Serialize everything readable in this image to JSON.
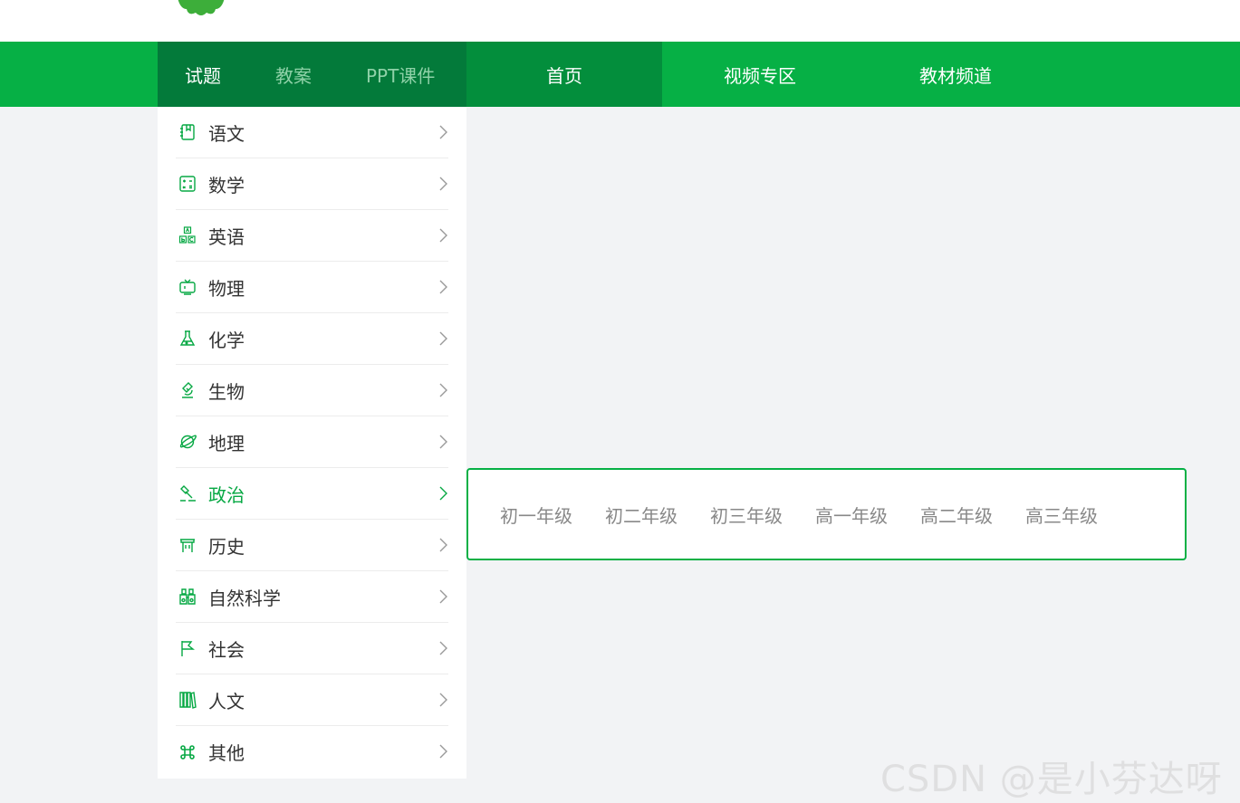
{
  "header": {
    "tabs": [
      {
        "label": "试题",
        "active": true
      },
      {
        "label": "教案",
        "active": false
      },
      {
        "label": "PPT课件",
        "active": false
      }
    ],
    "links": {
      "home": "首页",
      "video": "视频专区",
      "textbook": "教材频道"
    }
  },
  "sidebar": {
    "items": [
      {
        "label": "语文",
        "icon": "book-icon"
      },
      {
        "label": "数学",
        "icon": "calculator-icon"
      },
      {
        "label": "英语",
        "icon": "abc-blocks-icon"
      },
      {
        "label": "物理",
        "icon": "tv-icon"
      },
      {
        "label": "化学",
        "icon": "flask-icon"
      },
      {
        "label": "生物",
        "icon": "microscope-icon"
      },
      {
        "label": "地理",
        "icon": "planet-icon"
      },
      {
        "label": "政治",
        "icon": "gavel-icon",
        "active": true
      },
      {
        "label": "历史",
        "icon": "scroll-icon"
      },
      {
        "label": "自然科学",
        "icon": "binoculars-icon"
      },
      {
        "label": "社会",
        "icon": "flag-icon"
      },
      {
        "label": "人文",
        "icon": "books-icon"
      },
      {
        "label": "其他",
        "icon": "command-icon"
      }
    ]
  },
  "grades": [
    "初一年级",
    "初二年级",
    "初三年级",
    "高一年级",
    "高二年级",
    "高三年级"
  ],
  "watermark": "CSDN @是小芬达呀",
  "colors": {
    "primary": "#06b045",
    "tab_bar": "#037a3a",
    "home_bg": "#038e3c",
    "active_text": "#06a843",
    "page_bg": "#f2f3f5"
  }
}
